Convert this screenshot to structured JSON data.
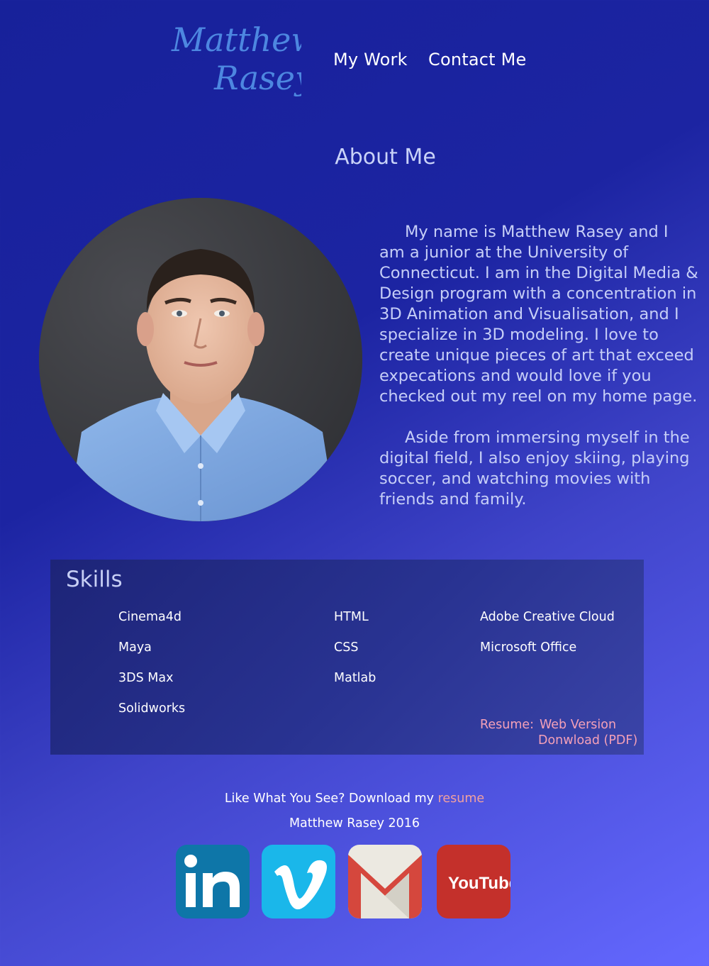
{
  "header": {
    "logo_line1": "Matthew",
    "logo_line2": "Rasey",
    "nav": [
      {
        "label": "My Work"
      },
      {
        "label": "Contact Me"
      }
    ]
  },
  "about": {
    "title": "About Me",
    "paragraphs": [
      "My name is Matthew Rasey and I am a junior at the University of Connecticut. I am in the Digital Media & Design program with a concentration in 3D Animation and Visualisation, and I specialize in 3D modeling.  I love to create unique pieces of art that exceed expecations and would love if you checked out my reel on my home page.",
      "Aside from immersing myself in the digital field, I also enjoy skiing, playing soccer, and watching movies with friends and family."
    ]
  },
  "skills": {
    "title": "Skills",
    "columns": [
      [
        "Cinema4d",
        "Maya",
        "3DS Max",
        "Solidworks"
      ],
      [
        "HTML",
        "CSS",
        "Matlab"
      ],
      [
        "Adobe Creative Cloud",
        "Microsoft Office"
      ]
    ],
    "resume_label": "Resume:",
    "resume_links": [
      "Web Version",
      "Donwload (PDF)"
    ]
  },
  "footer": {
    "cta_text": "Like What You See? Download my",
    "cta_link": "resume",
    "copyright": "Matthew Rasey 2016",
    "social": [
      {
        "name": "LinkedIn",
        "icon": "linkedin-icon",
        "text": "in",
        "color": "#0e76a8"
      },
      {
        "name": "Vimeo",
        "icon": "vimeo-icon",
        "text": "v",
        "color": "#1ab7ea"
      },
      {
        "name": "Gmail",
        "icon": "gmail-icon",
        "color": "#d14836"
      },
      {
        "name": "YouTube",
        "icon": "youtube-icon",
        "text": "YouTube",
        "color": "#c4302b"
      }
    ]
  }
}
